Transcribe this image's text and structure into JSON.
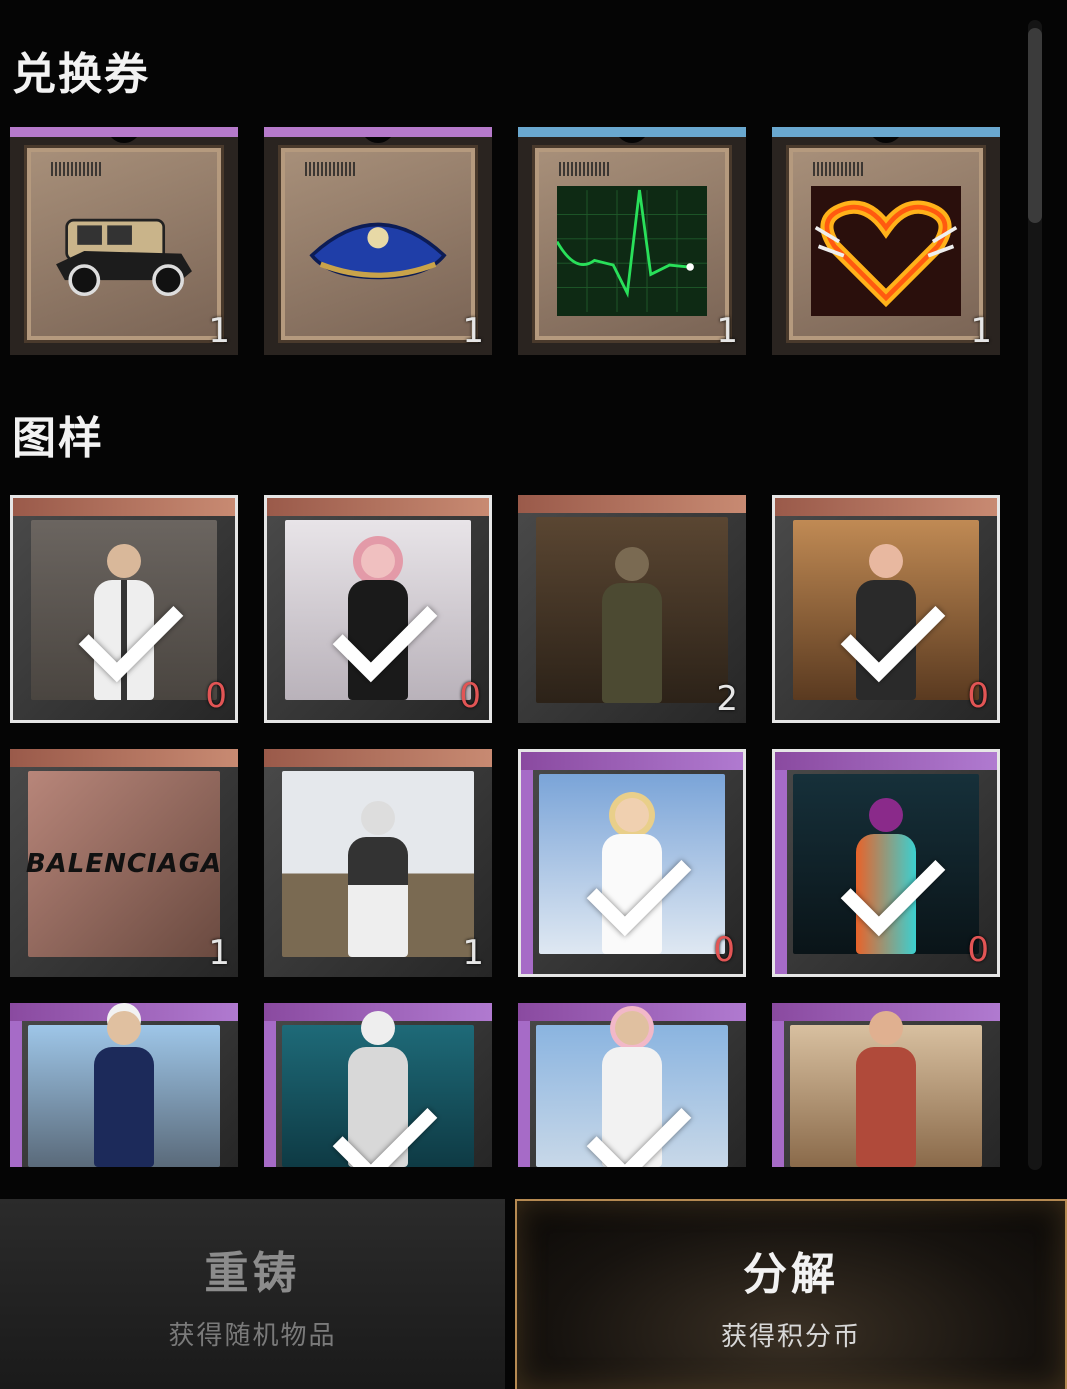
{
  "sections": {
    "tickets_title": "兑换券",
    "patterns_title": "图样"
  },
  "tickets": [
    {
      "icon": "vintage-car-icon",
      "count": "1",
      "band_color": "#b67acb"
    },
    {
      "icon": "parachute-icon",
      "count": "1",
      "band_color": "#b67acb"
    },
    {
      "icon": "heartbeat-monitor-icon",
      "count": "1",
      "band_color": "#6aa8cf"
    },
    {
      "icon": "flaming-heart-icon",
      "count": "1",
      "band_color": "#6aa8cf"
    }
  ],
  "patterns": [
    {
      "icon": "outfit-streetwear-man-icon",
      "count": "0",
      "selected": true
    },
    {
      "icon": "outfit-pink-hair-woman-icon",
      "count": "0",
      "selected": true
    },
    {
      "icon": "outfit-masked-soldier-icon",
      "count": "2",
      "selected": false
    },
    {
      "icon": "outfit-pigtails-woman-icon",
      "count": "0",
      "selected": true
    },
    {
      "icon": "balenciaga-graffiti-icon",
      "count": "1",
      "selected": false,
      "text": "BALENCIAGA"
    },
    {
      "icon": "outfit-winter-helmet-icon",
      "count": "1",
      "selected": false
    },
    {
      "icon": "outfit-white-dress-woman-icon",
      "count": "0",
      "selected": true
    },
    {
      "icon": "outfit-neon-jacket-icon",
      "count": "0",
      "selected": true
    },
    {
      "icon": "outfit-naval-uniform-icon",
      "count": "",
      "selected": false
    },
    {
      "icon": "outfit-white-hood-icon",
      "count": "",
      "selected": false
    },
    {
      "icon": "outfit-goggles-icon",
      "count": "",
      "selected": false
    },
    {
      "icon": "outfit-red-jacket-woman-icon",
      "count": "",
      "selected": false
    }
  ],
  "buttons": {
    "recast": {
      "title": "重铸",
      "subtitle": "获得随机物品"
    },
    "decompose": {
      "title": "分解",
      "subtitle": "获得积分币"
    }
  }
}
